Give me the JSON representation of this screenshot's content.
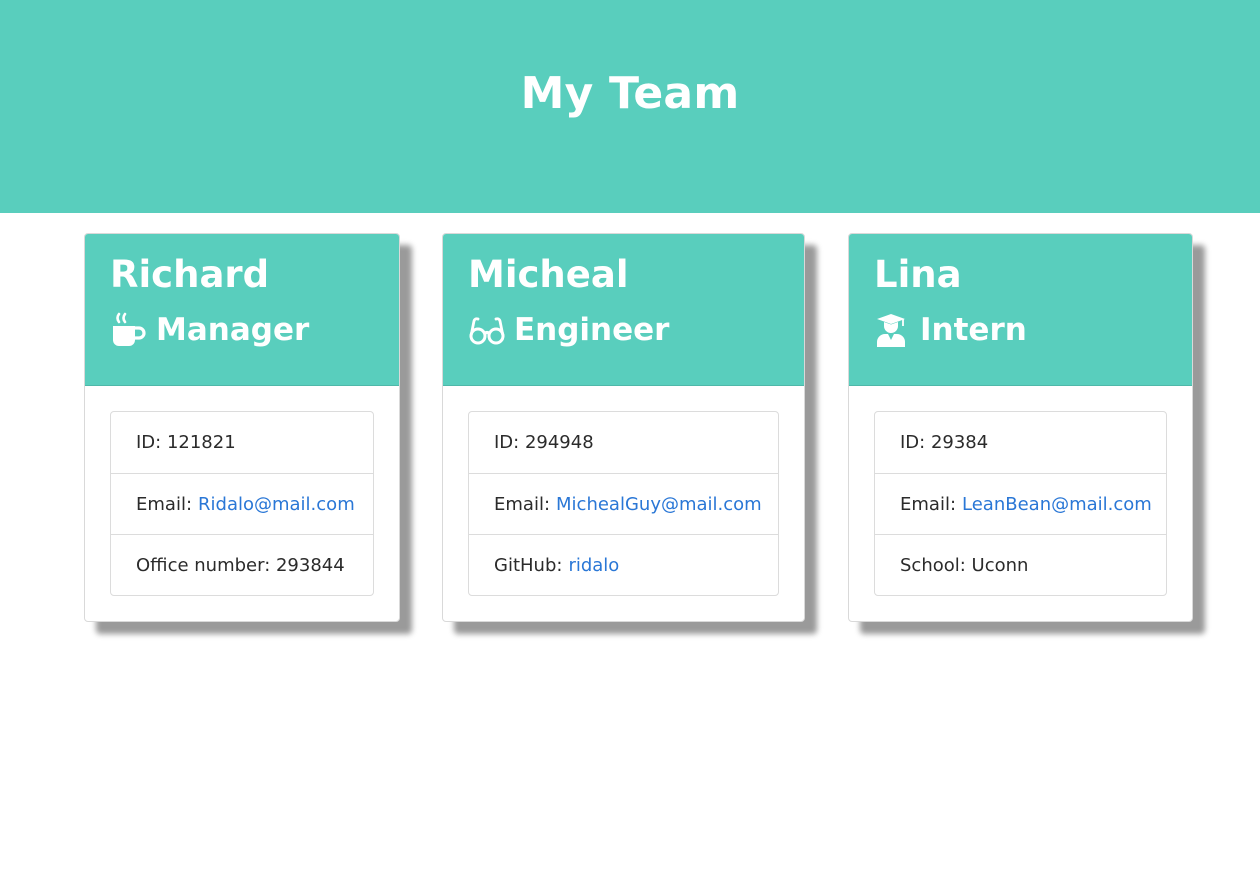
{
  "header": {
    "title": "My Team"
  },
  "team": [
    {
      "name": "Richard",
      "role": "Manager",
      "icon": "coffee-mug-icon",
      "id_text": "ID: 121821",
      "email_label": "Email:",
      "email": "Ridalo@mail.com",
      "extra_label": "Office number: 293844",
      "extra_link": ""
    },
    {
      "name": "Micheal",
      "role": "Engineer",
      "icon": "glasses-icon",
      "id_text": "ID: 294948",
      "email_label": "Email:",
      "email": "MichealGuy@mail.com",
      "extra_label": "GitHub:",
      "extra_link": "ridalo"
    },
    {
      "name": "Lina",
      "role": "Intern",
      "icon": "graduate-icon",
      "id_text": "ID: 29384",
      "email_label": "Email:",
      "email": "LeanBean@mail.com",
      "extra_label": "School: Uconn",
      "extra_link": ""
    }
  ],
  "colors": {
    "accent": "#59cebd",
    "link": "#2a77d6"
  }
}
